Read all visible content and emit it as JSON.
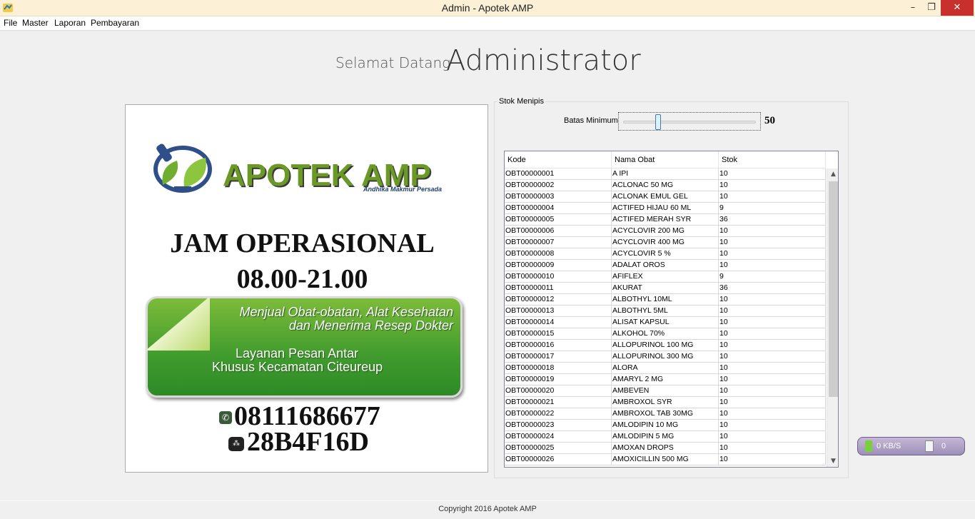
{
  "window": {
    "title": "Admin - Apotek AMP",
    "min_glyph": "–",
    "max_glyph": "❐",
    "close_glyph": "✕"
  },
  "menu": {
    "items": [
      "File",
      "Master",
      "Laporan",
      "Pembayaran"
    ]
  },
  "welcome": {
    "greeting": "Selamat Datang",
    "user": "Administrator"
  },
  "poster": {
    "brand": "APOTEK AMP",
    "brand_sub": "Andhika Makmur Persada",
    "heading": "JAM OPERASIONAL",
    "hours": "08.00-21.00",
    "banner_line1": "Menjual Obat-obatan, Alat Kesehatan",
    "banner_line2": "dan Menerima Resep Dokter",
    "banner_line3": "Layanan Pesan Antar",
    "banner_line4": "Khusus Kecamatan Citeureup",
    "phone": "08111686677",
    "bbm_pin": "28B4F16D",
    "brand_color": "#6a9a25"
  },
  "stok": {
    "group_label": "Stok Menipis",
    "batas_label": "Batas Minimum",
    "batas_value": "50",
    "slider_fraction": 0.25,
    "columns": [
      "Kode",
      "Nama Obat",
      "Stok"
    ],
    "rows": [
      [
        "OBT00000001",
        "A IPI",
        "10"
      ],
      [
        "OBT00000002",
        "ACLONAC 50 MG",
        "10"
      ],
      [
        "OBT00000003",
        "ACLONAK EMUL GEL",
        "10"
      ],
      [
        "OBT00000004",
        "ACTIFED HIJAU 60 ML",
        "9"
      ],
      [
        "OBT00000005",
        "ACTIFED MERAH SYR",
        "36"
      ],
      [
        "OBT00000006",
        "ACYCLOVIR 200 MG",
        "10"
      ],
      [
        "OBT00000007",
        "ACYCLOVIR 400 MG",
        "10"
      ],
      [
        "OBT00000008",
        "ACYCLOVIR 5 %",
        "10"
      ],
      [
        "OBT00000009",
        "ADALAT OROS",
        "10"
      ],
      [
        "OBT00000010",
        "AFIFLEX",
        "9"
      ],
      [
        "OBT00000011",
        "AKURAT",
        "36"
      ],
      [
        "OBT00000012",
        "ALBOTHYL 10ML",
        "10"
      ],
      [
        "OBT00000013",
        "ALBOTHYL 5ML",
        "10"
      ],
      [
        "OBT00000014",
        "ALISAT KAPSUL",
        "10"
      ],
      [
        "OBT00000015",
        "ALKOHOL 70%",
        "10"
      ],
      [
        "OBT00000016",
        "ALLOPURINOL 100 MG",
        "10"
      ],
      [
        "OBT00000017",
        "ALLOPURINOL 300 MG",
        "10"
      ],
      [
        "OBT00000018",
        "ALORA",
        "10"
      ],
      [
        "OBT00000019",
        "AMARYL 2 MG",
        "10"
      ],
      [
        "OBT00000020",
        "AMBEVEN",
        "10"
      ],
      [
        "OBT00000021",
        "AMBROXOL SYR",
        "10"
      ],
      [
        "OBT00000022",
        "AMBROXOL TAB 30MG",
        "10"
      ],
      [
        "OBT00000023",
        "AMLODIPIN 10 MG",
        "10"
      ],
      [
        "OBT00000024",
        "AMLODIPIN 5 MG",
        "10"
      ],
      [
        "OBT00000025",
        "AMOXAN DROPS",
        "10"
      ],
      [
        "OBT00000026",
        "AMOXICILLIN 500 MG",
        "10"
      ]
    ]
  },
  "netmeter": {
    "speed": "0 KB/S",
    "count": "0"
  },
  "footer": {
    "copyright": "Copyright 2016 Apotek AMP"
  }
}
